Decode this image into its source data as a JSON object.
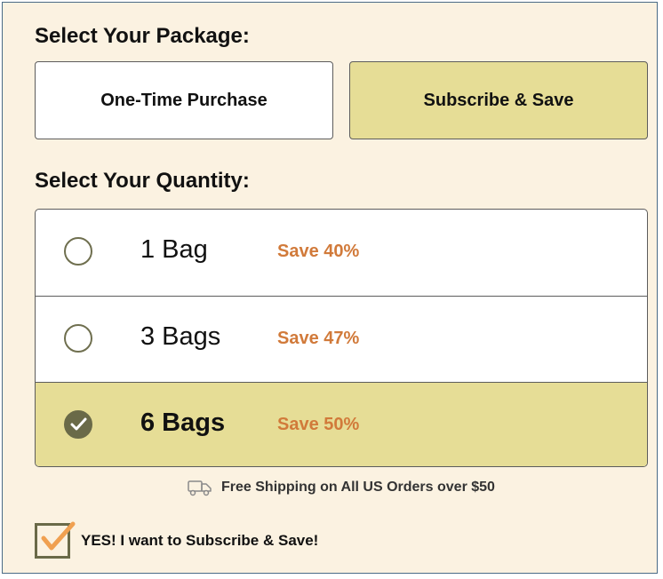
{
  "package": {
    "heading": "Select Your Package:",
    "options": [
      {
        "label": "One-Time Purchase",
        "selected": false
      },
      {
        "label": "Subscribe & Save",
        "selected": true
      }
    ]
  },
  "quantity": {
    "heading": "Select Your Quantity:",
    "options": [
      {
        "label": "1 Bag",
        "save": "Save 40%",
        "selected": false
      },
      {
        "label": "3 Bags",
        "save": "Save 47%",
        "selected": false
      },
      {
        "label": "6 Bags",
        "save": "Save 50%",
        "selected": true
      }
    ]
  },
  "shipping": {
    "icon": "truck-icon",
    "text": "Free Shipping on All US Orders over $50"
  },
  "subscribe_opt_in": {
    "label": "YES! I want to Subscribe & Save!",
    "checked": true
  },
  "colors": {
    "background": "#fbf2e1",
    "selected": "#e6dd96",
    "accent": "#d17a3a",
    "check_fill": "#6a6a48",
    "checkmark_orange": "#f0a050"
  }
}
